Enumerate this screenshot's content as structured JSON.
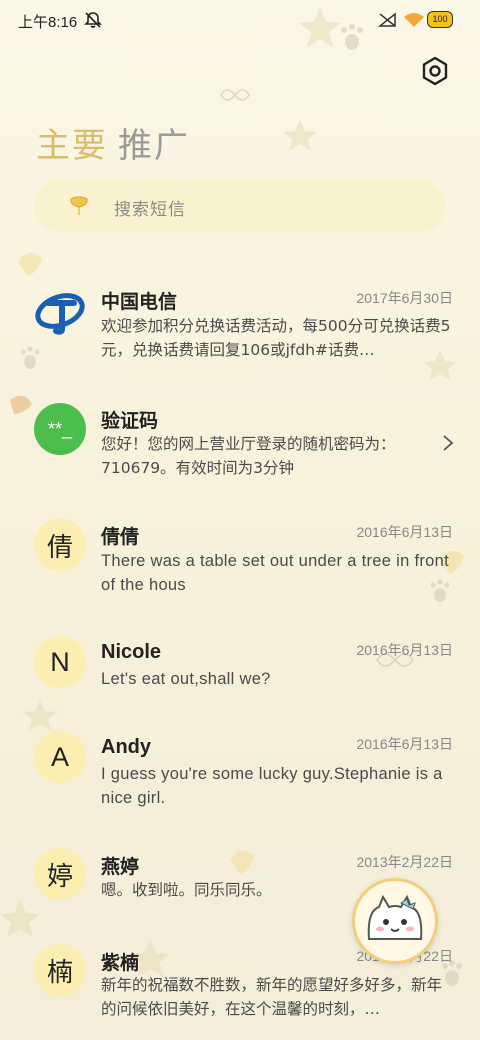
{
  "status_bar": {
    "time": "上午8:16",
    "battery": "100",
    "icons": [
      "mute-icon",
      "signal-icon",
      "wifi-icon",
      "battery-icon"
    ]
  },
  "header": {
    "tab_main": "主要",
    "tab_promo": "推广",
    "settings_icon": "gear-icon"
  },
  "search": {
    "placeholder": "搜索短信"
  },
  "colors": {
    "accent": "#d9bd6b",
    "avatar_bg": "#fbeeb0",
    "telecom_blue": "#1a5fb4",
    "verify_green": "#4cbe4c"
  },
  "messages": [
    {
      "avatar": "telecom-logo-icon",
      "sender": "中国电信",
      "date": "2017年6月30日",
      "preview": "欢迎参加积分兑换话费活动，每500分可兑换话费5元，兑换话费请回复106或jfdh#话费…"
    },
    {
      "avatar": "**_",
      "sender": "验证码",
      "date": "",
      "preview": "您好！您的网上营业厅登录的随机密码为：710679。有效时间为3分钟"
    },
    {
      "avatar": "倩",
      "sender": "倩倩",
      "date": "2016年6月13日",
      "preview": "There was a table set out under a tree in front of the hous"
    },
    {
      "avatar": "N",
      "sender": "Nicole",
      "date": "2016年6月13日",
      "preview": "Let's eat out,shall we?"
    },
    {
      "avatar": "A",
      "sender": "Andy",
      "date": "2016年6月13日",
      "preview": "I guess you're some lucky guy.Stephanie is a nice girl."
    },
    {
      "avatar": "婷",
      "sender": "燕婷",
      "date": "2013年2月22日",
      "preview": "嗯。收到啦。同乐同乐。"
    },
    {
      "avatar": "楠",
      "sender": "紫楠",
      "date": "2013年2月22日",
      "preview": "新年的祝福数不胜数，新年的愿望好多好多，新年的问候依旧美好，在这个温馨的时刻，…"
    }
  ],
  "fab": {
    "icon": "cat-face-icon"
  }
}
